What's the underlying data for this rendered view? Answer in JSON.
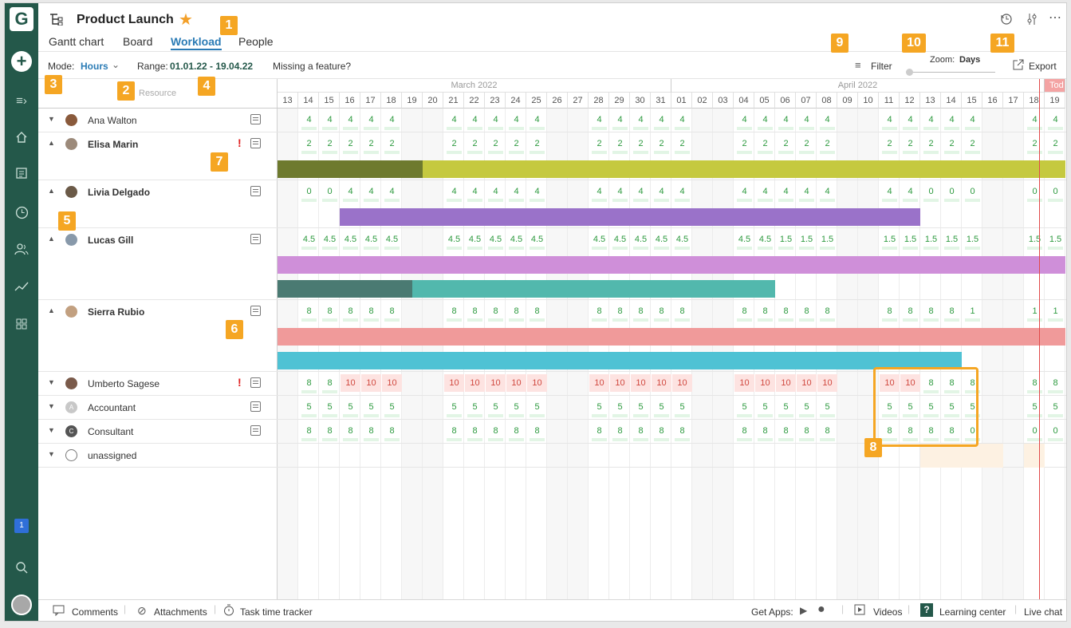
{
  "app": {
    "logo": "G",
    "title": "Product Launch"
  },
  "tabs": [
    {
      "label": "Gantt chart"
    },
    {
      "label": "Board"
    },
    {
      "label": "Workload"
    },
    {
      "label": "People"
    }
  ],
  "toolbar": {
    "mode_label": "Mode:",
    "mode_value": "Hours",
    "range_label": "Range:",
    "range_value": "01.01.22 - 19.04.22",
    "missing": "Missing a feature?",
    "filter": "Filter",
    "zoom_label": "Zoom:",
    "zoom_value": "Days",
    "export": "Export"
  },
  "panel_header": "Resource",
  "months": [
    {
      "label": "March 2022"
    },
    {
      "label": "April 2022"
    },
    {
      "label": "Tod"
    }
  ],
  "days": [
    "13",
    "14",
    "15",
    "16",
    "17",
    "18",
    "19",
    "20",
    "21",
    "22",
    "23",
    "24",
    "25",
    "26",
    "27",
    "28",
    "29",
    "30",
    "31",
    "01",
    "02",
    "03",
    "04",
    "05",
    "06",
    "07",
    "08",
    "09",
    "10",
    "11",
    "12",
    "13",
    "14",
    "15",
    "16",
    "17",
    "18",
    "19"
  ],
  "weekend_indexes": [
    0,
    6,
    7,
    13,
    14,
    20,
    21,
    27,
    28,
    34,
    35
  ],
  "today_index": 37,
  "resources": [
    {
      "name": "Ana Walton",
      "bold": false,
      "expanded": false,
      "warn": false,
      "avatar_color": "#8a5a3c",
      "values": [
        "",
        "4",
        "4",
        "4",
        "4",
        "4",
        "",
        "",
        "4",
        "4",
        "4",
        "4",
        "4",
        "",
        "",
        "4",
        "4",
        "4",
        "4",
        "4",
        "",
        "",
        "4",
        "4",
        "4",
        "4",
        "4",
        "",
        "",
        "4",
        "4",
        "4",
        "4",
        "4",
        "",
        "",
        "4",
        "4"
      ],
      "status": "ok",
      "bars": []
    },
    {
      "name": "Elisa Marin",
      "bold": true,
      "expanded": true,
      "warn": true,
      "avatar_color": "#9c8a7a",
      "values": [
        "",
        "2",
        "2",
        "2",
        "2",
        "2",
        "",
        "",
        "2",
        "2",
        "2",
        "2",
        "2",
        "",
        "",
        "2",
        "2",
        "2",
        "2",
        "2",
        "",
        "",
        "2",
        "2",
        "2",
        "2",
        "2",
        "",
        "",
        "2",
        "2",
        "2",
        "2",
        "2",
        "",
        "",
        "2",
        "2"
      ],
      "status": "ok",
      "bars": [
        {
          "color": "#6e7a2e",
          "start": 0,
          "end": 7
        },
        {
          "color": "#c5c93f",
          "start": 7,
          "end": 38
        }
      ]
    },
    {
      "name": "Livia Delgado",
      "bold": true,
      "expanded": true,
      "warn": false,
      "avatar_color": "#6b5a48",
      "values": [
        "",
        "0",
        "0",
        "4",
        "4",
        "4",
        "",
        "",
        "4",
        "4",
        "4",
        "4",
        "4",
        "",
        "",
        "4",
        "4",
        "4",
        "4",
        "4",
        "",
        "",
        "4",
        "4",
        "4",
        "4",
        "4",
        "",
        "",
        "4",
        "4",
        "0",
        "0",
        "0",
        "",
        "",
        "0",
        "0"
      ],
      "status": "ok",
      "bars": [
        {
          "color": "#9a72c9",
          "start": 3,
          "end": 31
        }
      ]
    },
    {
      "name": "Lucas Gill",
      "bold": true,
      "expanded": true,
      "warn": false,
      "avatar_color": "#8899aa",
      "values": [
        "",
        "4.5",
        "4.5",
        "4.5",
        "4.5",
        "4.5",
        "",
        "",
        "4.5",
        "4.5",
        "4.5",
        "4.5",
        "4.5",
        "",
        "",
        "4.5",
        "4.5",
        "4.5",
        "4.5",
        "4.5",
        "",
        "",
        "4.5",
        "4.5",
        "1.5",
        "1.5",
        "1.5",
        "",
        "",
        "1.5",
        "1.5",
        "1.5",
        "1.5",
        "1.5",
        "",
        "",
        "1.5",
        "1.5"
      ],
      "status": "ok",
      "bars": [
        {
          "color": "#cf8fd9",
          "start": 0,
          "end": 38
        },
        {
          "color": "#4a7a72",
          "start": 0,
          "end": 6.5
        },
        {
          "color": "#52b8ad",
          "start": 6.5,
          "end": 24
        }
      ]
    },
    {
      "name": "Sierra Rubio",
      "bold": true,
      "expanded": true,
      "warn": false,
      "avatar_color": "#c2a080",
      "values": [
        "",
        "8",
        "8",
        "8",
        "8",
        "8",
        "",
        "",
        "8",
        "8",
        "8",
        "8",
        "8",
        "",
        "",
        "8",
        "8",
        "8",
        "8",
        "8",
        "",
        "",
        "8",
        "8",
        "8",
        "8",
        "8",
        "",
        "",
        "8",
        "8",
        "8",
        "8",
        "1",
        "",
        "",
        "1",
        "1"
      ],
      "status": "ok",
      "bars": [
        {
          "color": "#f09a9a",
          "start": 0,
          "end": 38
        },
        {
          "color": "#4fc2d4",
          "start": 0,
          "end": 33
        }
      ]
    },
    {
      "name": "Umberto Sagese",
      "bold": false,
      "expanded": false,
      "warn": true,
      "avatar_color": "#7a5a4a",
      "values": [
        "",
        "8",
        "8",
        "10",
        "10",
        "10",
        "",
        "",
        "10",
        "10",
        "10",
        "10",
        "10",
        "",
        "",
        "10",
        "10",
        "10",
        "10",
        "10",
        "",
        "",
        "10",
        "10",
        "10",
        "10",
        "10",
        "",
        "",
        "10",
        "10",
        "8",
        "8",
        "8",
        "",
        "",
        "8",
        "8"
      ],
      "status": "mixed",
      "bars": []
    },
    {
      "name": "Accountant",
      "bold": false,
      "expanded": false,
      "warn": false,
      "avatar_color": "#c8c8c8",
      "avatar_letter": "A",
      "values": [
        "",
        "5",
        "5",
        "5",
        "5",
        "5",
        "",
        "",
        "5",
        "5",
        "5",
        "5",
        "5",
        "",
        "",
        "5",
        "5",
        "5",
        "5",
        "5",
        "",
        "",
        "5",
        "5",
        "5",
        "5",
        "5",
        "",
        "",
        "5",
        "5",
        "5",
        "5",
        "5",
        "",
        "",
        "5",
        "5"
      ],
      "status": "ok",
      "bars": []
    },
    {
      "name": "Consultant",
      "bold": false,
      "expanded": false,
      "warn": false,
      "avatar_color": "#555555",
      "avatar_letter": "C",
      "values": [
        "",
        "8",
        "8",
        "8",
        "8",
        "8",
        "",
        "",
        "8",
        "8",
        "8",
        "8",
        "8",
        "",
        "",
        "8",
        "8",
        "8",
        "8",
        "8",
        "",
        "",
        "8",
        "8",
        "8",
        "8",
        "8",
        "",
        "",
        "8",
        "8",
        "8",
        "8",
        "0",
        "",
        "",
        "0",
        "0"
      ],
      "status": "ok",
      "bars": []
    },
    {
      "name": "unassigned",
      "bold": false,
      "expanded": false,
      "warn": false,
      "avatar_color": "#ffffff",
      "values": [],
      "status": "none",
      "bars": []
    }
  ],
  "badges": [
    "1",
    "2",
    "3",
    "4",
    "5",
    "6",
    "7",
    "8",
    "9",
    "10",
    "11"
  ],
  "footer": {
    "comments": "Comments",
    "attachments": "Attachments",
    "tracker": "Task time tracker",
    "get_apps": "Get Apps:",
    "videos": "Videos",
    "learning": "Learning center",
    "live_chat": "Live chat"
  },
  "notification_count": "1",
  "colors": {
    "sidebar": "#24584a",
    "accent": "#2a7bb5",
    "badge": "#f5a623",
    "ok_text": "#2d9a3f",
    "over_text": "#d0483f",
    "today_line": "#e24a4a"
  }
}
